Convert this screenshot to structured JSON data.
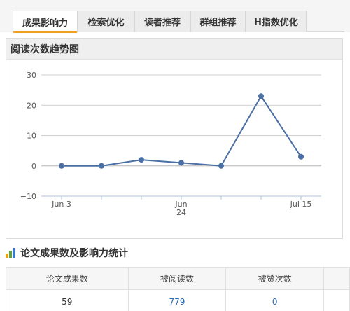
{
  "colors": {
    "accent": "#f0a020",
    "line": "#4a6fa5",
    "link": "#2a6bb5"
  },
  "tabs": [
    {
      "label": "成果影响力",
      "active": true
    },
    {
      "label": "检索优化",
      "active": false
    },
    {
      "label": "读者推荐",
      "active": false
    },
    {
      "label": "群组推荐",
      "active": false
    },
    {
      "label": "H指数优化",
      "active": false
    }
  ],
  "panel": {
    "title": "阅读次数趋势图"
  },
  "chart_data": {
    "type": "line",
    "title": "",
    "xlabel": "",
    "ylabel": "",
    "ylim": [
      -10,
      30
    ],
    "yticks": [
      -10,
      0,
      10,
      20,
      30
    ],
    "x": [
      "Jun 3",
      "Jun 10",
      "Jun 17",
      "Jun 24",
      "Jul 1",
      "Jul 8",
      "Jul 15"
    ],
    "x_tick_labels": [
      {
        "x": "Jun 3",
        "lines": [
          "Jun 3"
        ]
      },
      {
        "x": "Jun 24",
        "lines": [
          "Jun",
          "24"
        ]
      },
      {
        "x": "Jul 15",
        "lines": [
          "Jul 15"
        ]
      }
    ],
    "series": [
      {
        "values": [
          0,
          0,
          2,
          1,
          0,
          23,
          3
        ]
      }
    ],
    "grid": true
  },
  "stats": {
    "title": "论文成果数及影响力统计",
    "icon": "bar-chart-icon",
    "columns": [
      "论文成果数",
      "被阅读数",
      "被赞次数",
      ""
    ],
    "row": [
      "59",
      "779",
      "0",
      ""
    ]
  }
}
